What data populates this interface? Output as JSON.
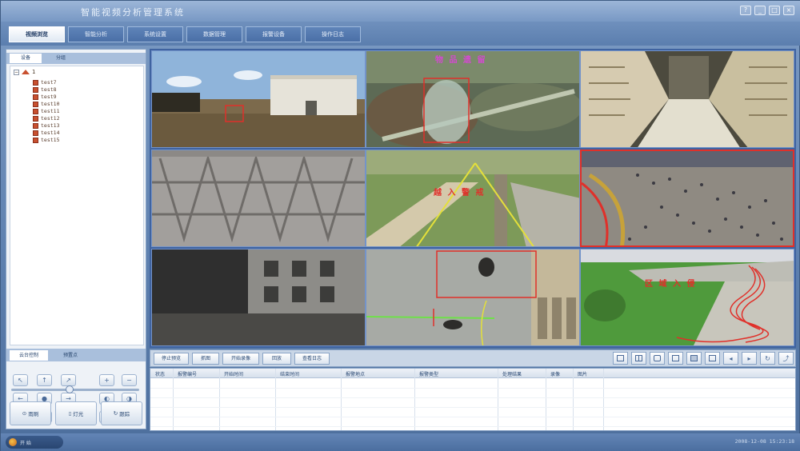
{
  "window": {
    "title": "智能视频分析管理系统",
    "controls": [
      "?",
      "_",
      "□",
      "×"
    ]
  },
  "main_tabs": [
    "视频浏览",
    "智能分析",
    "系统设置",
    "数据管理",
    "报警设备",
    "操作日志"
  ],
  "left_panel": {
    "subtabs": [
      "设备",
      "分组"
    ],
    "tree_root": "1",
    "tree_nodes": [
      "test7",
      "test8",
      "test9",
      "test10",
      "test11",
      "test12",
      "test13",
      "test14",
      "test15"
    ],
    "control_tabs": [
      "云台控制",
      "预置点"
    ],
    "big_buttons": [
      "雨刷",
      "灯光",
      "跟踪"
    ],
    "zoom_level": 0.45
  },
  "video_overlays": {
    "cam2_label": "物 品 遗 留",
    "cam5_label": "越 入 警 戒",
    "cam9_label": "区 域 入 侵"
  },
  "action_buttons": [
    "停止预览",
    "抓图",
    "开始录像",
    "回放",
    "查看日志"
  ],
  "layout_icons": [
    "one-view-icon",
    "four-view-icon",
    "six-view-icon",
    "eight-view-icon",
    "nine-view-icon",
    "fullscreen-icon",
    "previous-icon",
    "next-icon",
    "loop-icon",
    "exit-icon"
  ],
  "alarm_table": {
    "columns": [
      "状态",
      "报警编号",
      "开始时间",
      "结束时间",
      "报警地点",
      "报警类型",
      "处理结果",
      "录像",
      "图片"
    ],
    "rows": []
  },
  "statusbar": {
    "start_label": "开 始",
    "datetime": "2008-12-08 15:23:18"
  },
  "colors": {
    "frame": "#5c7fae",
    "grid_border": "#3f63a0",
    "alarm_red": "#e0302a",
    "alarm_magenta": "#d34ad0",
    "line_yellow": "#e4e03a",
    "line_green": "#6fe04a"
  }
}
